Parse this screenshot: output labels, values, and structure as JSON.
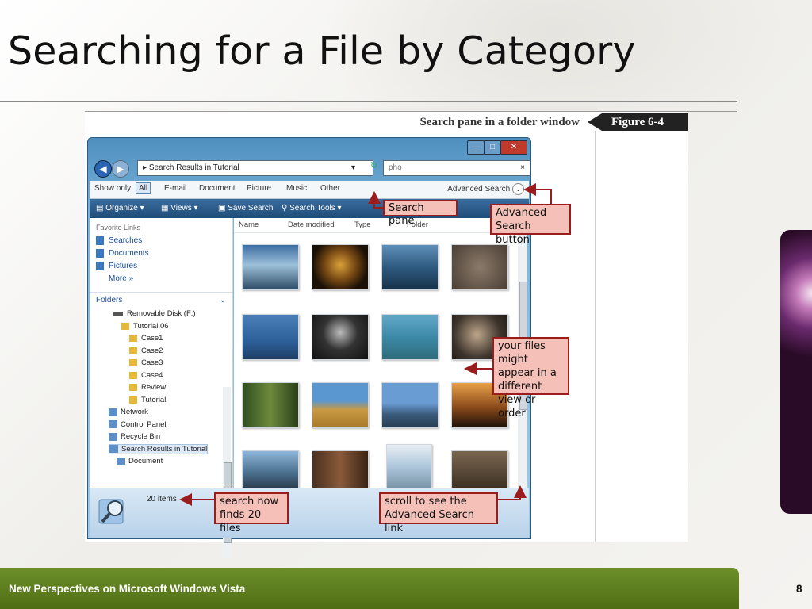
{
  "slide": {
    "title": "Searching for a File by Category",
    "footer": "New Perspectives on Microsoft Windows Vista",
    "page_number": "8"
  },
  "figure": {
    "caption": "Search pane in a folder window",
    "label": "Figure  6-4"
  },
  "window": {
    "address": "Search Results in Tutorial",
    "search_value": "pho",
    "show_only_label": "Show only:",
    "filters": [
      "All",
      "E-mail",
      "Document",
      "Picture",
      "Music",
      "Other"
    ],
    "advanced_search": "Advanced Search",
    "toolbar": [
      "Organize",
      "Views",
      "Save Search",
      "Search Tools"
    ],
    "favorite_links_header": "Favorite Links",
    "favorite_links": [
      "Searches",
      "Documents",
      "Pictures",
      "More"
    ],
    "folders_header": "Folders",
    "tree": [
      "Removable Disk (F:)",
      "Tutorial.06",
      "Case1",
      "Case2",
      "Case3",
      "Case4",
      "Review",
      "Tutorial",
      "Network",
      "Control Panel",
      "Recycle Bin",
      "Search Results in Tutorial",
      "Document"
    ],
    "columns": [
      "Name",
      "Date modified",
      "Type",
      "Folder"
    ],
    "item_count": "20 items"
  },
  "callouts": {
    "search_pane": "Search pane",
    "advanced_button": "Advanced Search button",
    "your_files": "your files might appear in a different view or order",
    "search_now": "search now finds 20 files",
    "scroll": "scroll to see the Advanced Search link"
  },
  "icons": {
    "back": "back-arrow-icon",
    "forward": "forward-arrow-icon",
    "search": "magnifier-icon"
  }
}
